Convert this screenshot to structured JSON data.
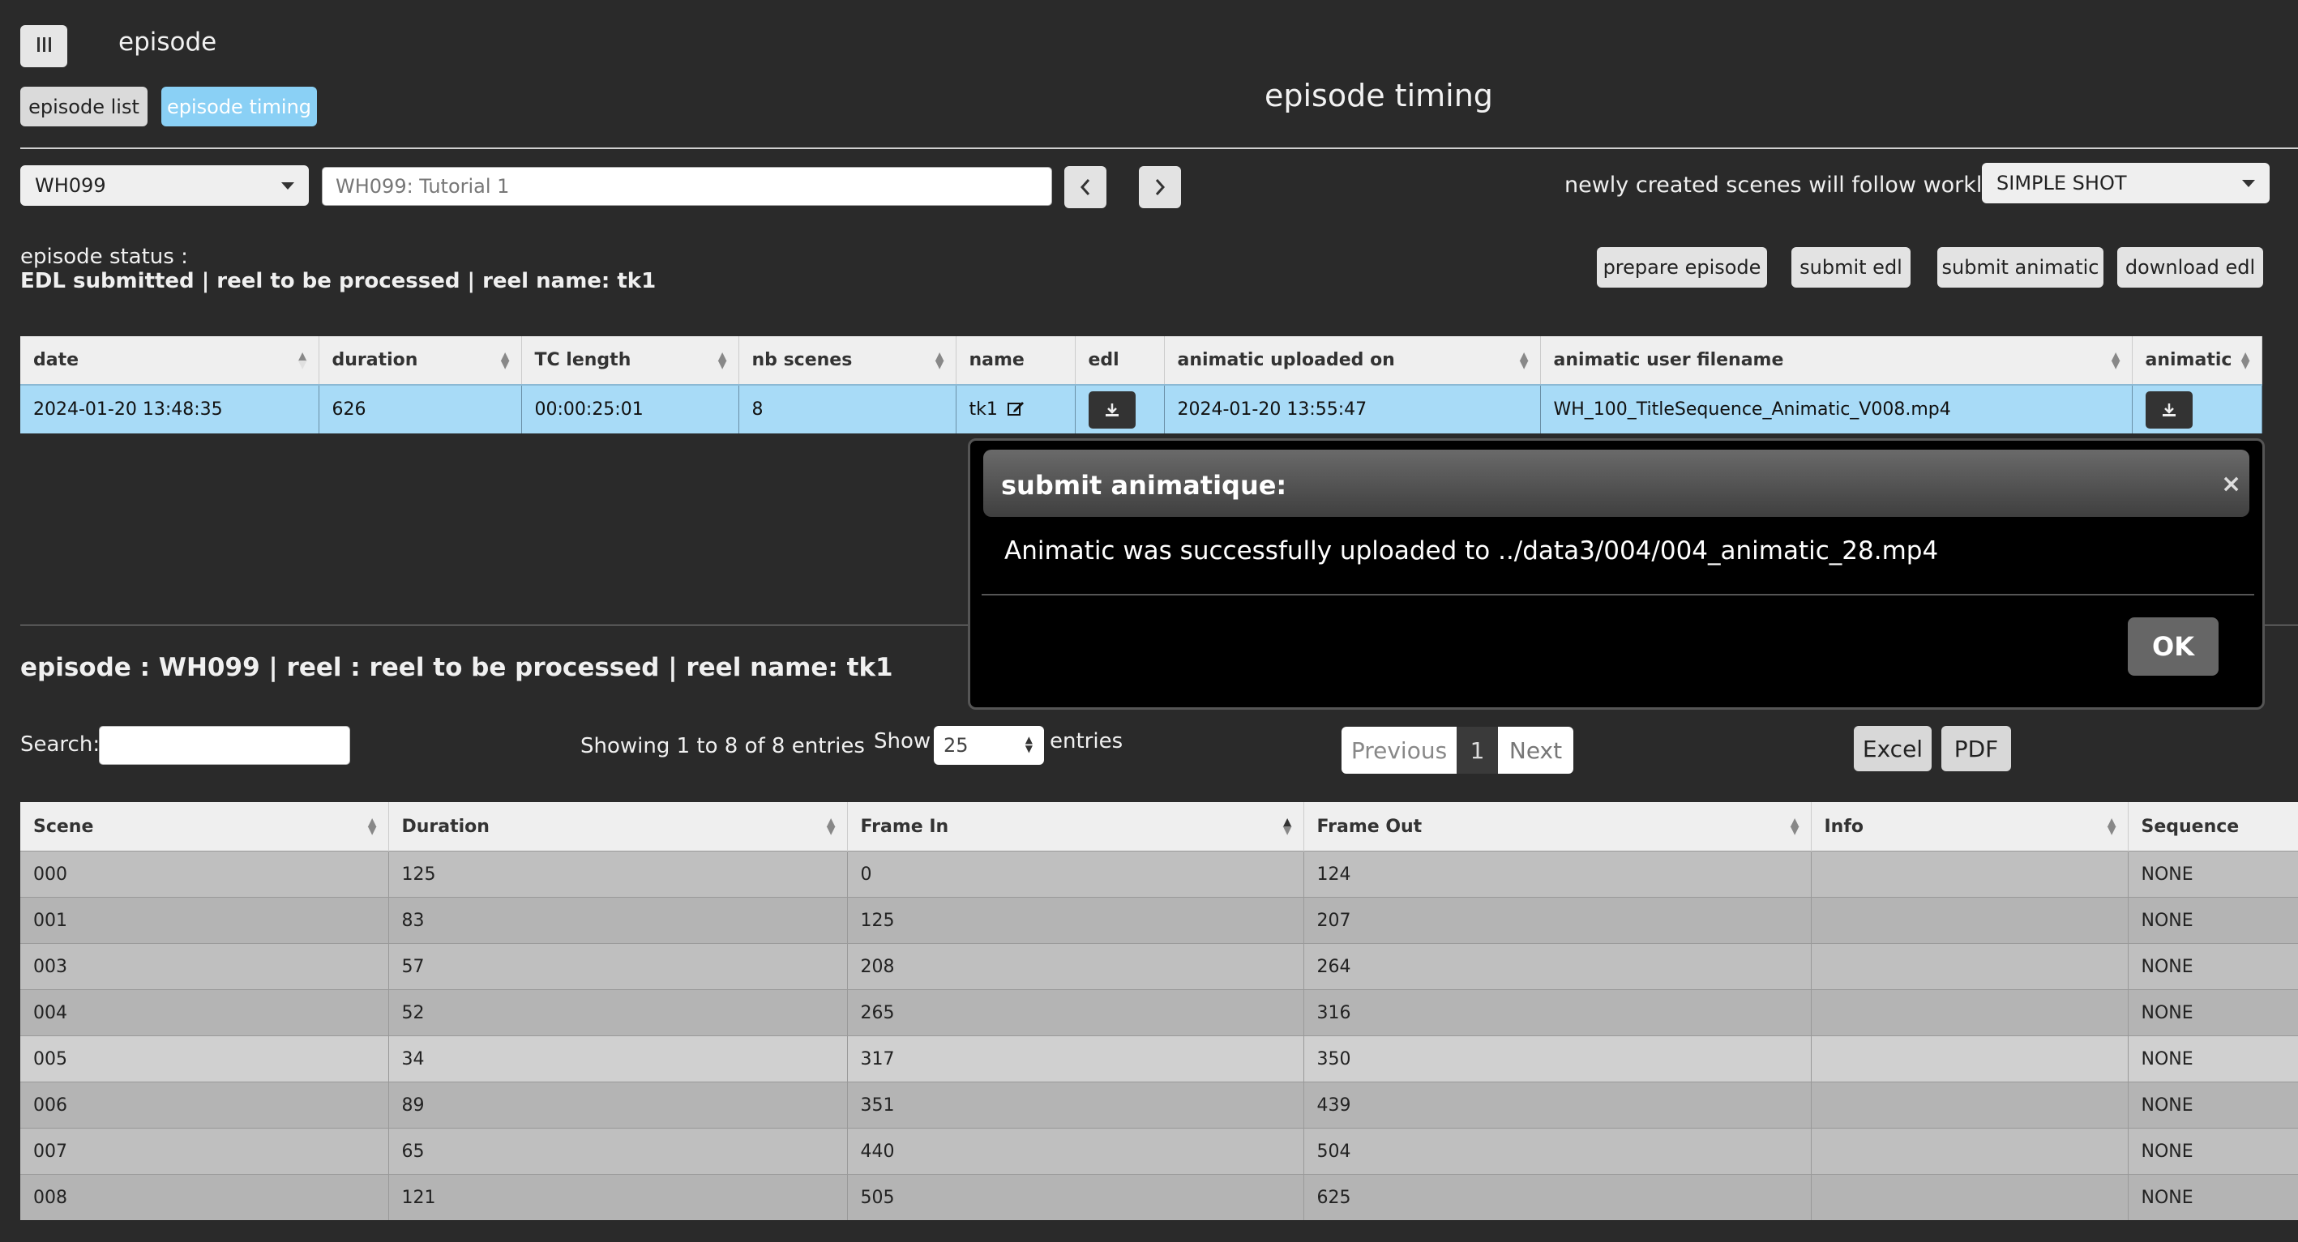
{
  "app": {
    "title": "episode",
    "page_title": "episode timing"
  },
  "tabs": {
    "list": "episode list",
    "timing": "episode timing"
  },
  "controls": {
    "episode_selected": "WH099",
    "episode_name_placeholder": "WH099: Tutorial 1",
    "workflow_label": "newly created scenes will follow worklow:",
    "workflow_selected": "SIMPLE SHOT"
  },
  "status": {
    "label": "episode status :",
    "value": "EDL submitted | reel to be processed | reel name: tk1"
  },
  "actions": {
    "prepare": "prepare episode",
    "submit_edl": "submit edl",
    "submit_animatic": "submit animatic",
    "download_edl": "download edl"
  },
  "timing_table": {
    "headers": [
      "date",
      "duration",
      "TC length",
      "nb scenes",
      "name",
      "edl",
      "animatic uploaded on",
      "animatic user filename",
      "animatic"
    ],
    "row": {
      "date": "2024-01-20 13:48:35",
      "duration": "626",
      "tc_length": "00:00:25:01",
      "nb_scenes": "8",
      "name": "tk1",
      "animatic_uploaded_on": "2024-01-20 13:55:47",
      "animatic_filename": "WH_100_TitleSequence_Animatic_V008.mp4"
    }
  },
  "section": {
    "title": "episode : WH099 | reel : reel to be processed | reel name: tk1",
    "search_label": "Search:",
    "entries_info": "Showing 1 to 8 of 8 entries",
    "show_label": "Show",
    "page_length": "25",
    "entries_label": "entries",
    "pagination": {
      "previous": "Previous",
      "current": "1",
      "next": "Next"
    },
    "export": {
      "excel": "Excel",
      "pdf": "PDF"
    }
  },
  "scenes_table": {
    "headers": [
      "Scene",
      "Duration",
      "Frame In",
      "Frame Out",
      "Info",
      "Sequence"
    ],
    "rows": [
      [
        "000",
        "125",
        "0",
        "124",
        "",
        "NONE"
      ],
      [
        "001",
        "83",
        "125",
        "207",
        "",
        "NONE"
      ],
      [
        "003",
        "57",
        "208",
        "264",
        "",
        "NONE"
      ],
      [
        "004",
        "52",
        "265",
        "316",
        "",
        "NONE"
      ],
      [
        "005",
        "34",
        "317",
        "350",
        "",
        "NONE"
      ],
      [
        "006",
        "89",
        "351",
        "439",
        "",
        "NONE"
      ],
      [
        "007",
        "65",
        "440",
        "504",
        "",
        "NONE"
      ],
      [
        "008",
        "121",
        "505",
        "625",
        "",
        "NONE"
      ]
    ]
  },
  "modal": {
    "title": "submit animatique:",
    "message": "Animatic was successfully uploaded to ../data3/004/004_animatic_28.mp4",
    "ok": "OK",
    "close_icon": "×"
  }
}
